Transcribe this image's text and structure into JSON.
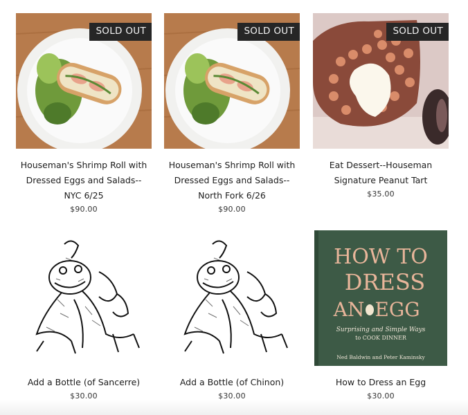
{
  "products": [
    {
      "name": "Houseman's Shrimp Roll with Dressed Eggs and Salads--NYC 6/25",
      "price": "$90.00",
      "badge": "SOLD OUT",
      "image": "shrimp-roll-photo"
    },
    {
      "name": "Houseman's Shrimp Roll with Dressed Eggs and Salads--North Fork 6/26",
      "price": "$90.00",
      "badge": "SOLD OUT",
      "image": "shrimp-roll-photo"
    },
    {
      "name": "Eat Dessert--Houseman Signature Peanut Tart",
      "price": "$35.00",
      "badge": "SOLD OUT",
      "image": "peanut-tart-photo"
    },
    {
      "name": "Add a Bottle (of Sancerre)",
      "price": "$30.00",
      "image": "frog-illustration"
    },
    {
      "name": "Add a Bottle (of Chinon)",
      "price": "$30.00",
      "image": "frog-illustration"
    },
    {
      "name": "How to Dress an Egg",
      "price": "$30.00",
      "image": "book-cover",
      "book": {
        "title_line1": "HOW TO",
        "title_line2": "DRESS",
        "title_line3a": "AN",
        "title_line3b": "EGG",
        "subtitle_line1": "Surprising and Simple Ways",
        "subtitle_line2": "to COOK DINNER",
        "authors": "Ned Baldwin and Peter Kaminsky"
      }
    }
  ],
  "colors": {
    "badge_bg": "#262626",
    "badge_text": "#f3f3f3",
    "book_green": "#3d5a46",
    "book_title": "#e8b59a"
  }
}
